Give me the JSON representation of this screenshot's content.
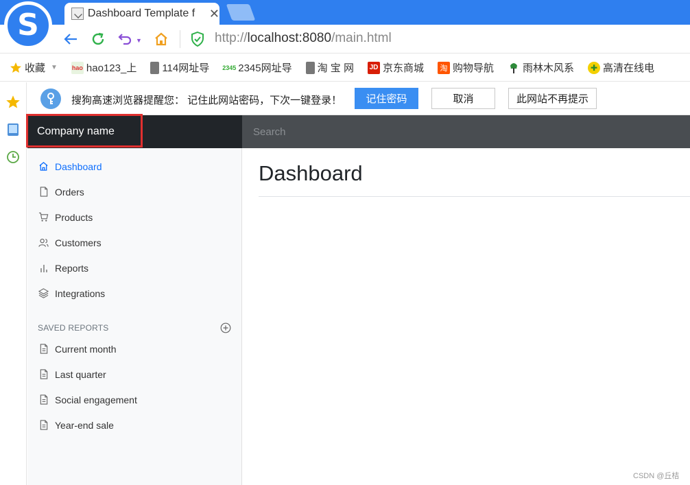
{
  "browser": {
    "tab_title": "Dashboard Template f",
    "tab_close": "✕",
    "url_prefix": "http://",
    "url_host": "localhost:8080",
    "url_path": "/main.html",
    "bookmarks": [
      {
        "label": "收藏",
        "icon": "star-icon"
      },
      {
        "label": "hao123_上",
        "icon": "hao123-icon"
      },
      {
        "label": "114网址导",
        "icon": "page-icon"
      },
      {
        "label": "2345网址导",
        "icon": "2345-icon"
      },
      {
        "label": "淘 宝 网",
        "icon": "page-icon"
      },
      {
        "label": "京东商城",
        "icon": "jd-icon"
      },
      {
        "label": "购物导航",
        "icon": "taobao-icon"
      },
      {
        "label": "雨林木风系",
        "icon": "tree-icon"
      },
      {
        "label": "高清在线电",
        "icon": "video-icon"
      }
    ],
    "password_prompt": {
      "message": "搜狗高速浏览器提醒您：  记住此网站密码，下次一键登录！",
      "save_label": "记住密码",
      "cancel_label": "取消",
      "never_label": "此网站不再提示"
    }
  },
  "app": {
    "brand": "Company name",
    "search_placeholder": "Search",
    "nav": [
      {
        "label": "Dashboard",
        "icon": "home-icon",
        "active": true
      },
      {
        "label": "Orders",
        "icon": "file-icon"
      },
      {
        "label": "Products",
        "icon": "cart-icon"
      },
      {
        "label": "Customers",
        "icon": "users-icon"
      },
      {
        "label": "Reports",
        "icon": "bar-chart-icon"
      },
      {
        "label": "Integrations",
        "icon": "layers-icon"
      }
    ],
    "saved_reports_heading": "SAVED REPORTS",
    "saved_reports": [
      {
        "label": "Current month",
        "icon": "file-text-icon"
      },
      {
        "label": "Last quarter",
        "icon": "file-text-icon"
      },
      {
        "label": "Social engagement",
        "icon": "file-text-icon"
      },
      {
        "label": "Year-end sale",
        "icon": "file-text-icon"
      }
    ],
    "page_title": "Dashboard"
  },
  "watermark": "CSDN @丘桔",
  "colors": {
    "browser_blue": "#2f7fef",
    "navbar_dark": "#212529",
    "search_bg": "#494d51",
    "active_link": "#0d6efd",
    "highlight_red": "#e0302f",
    "prompt_button": "#3a8ef2"
  }
}
